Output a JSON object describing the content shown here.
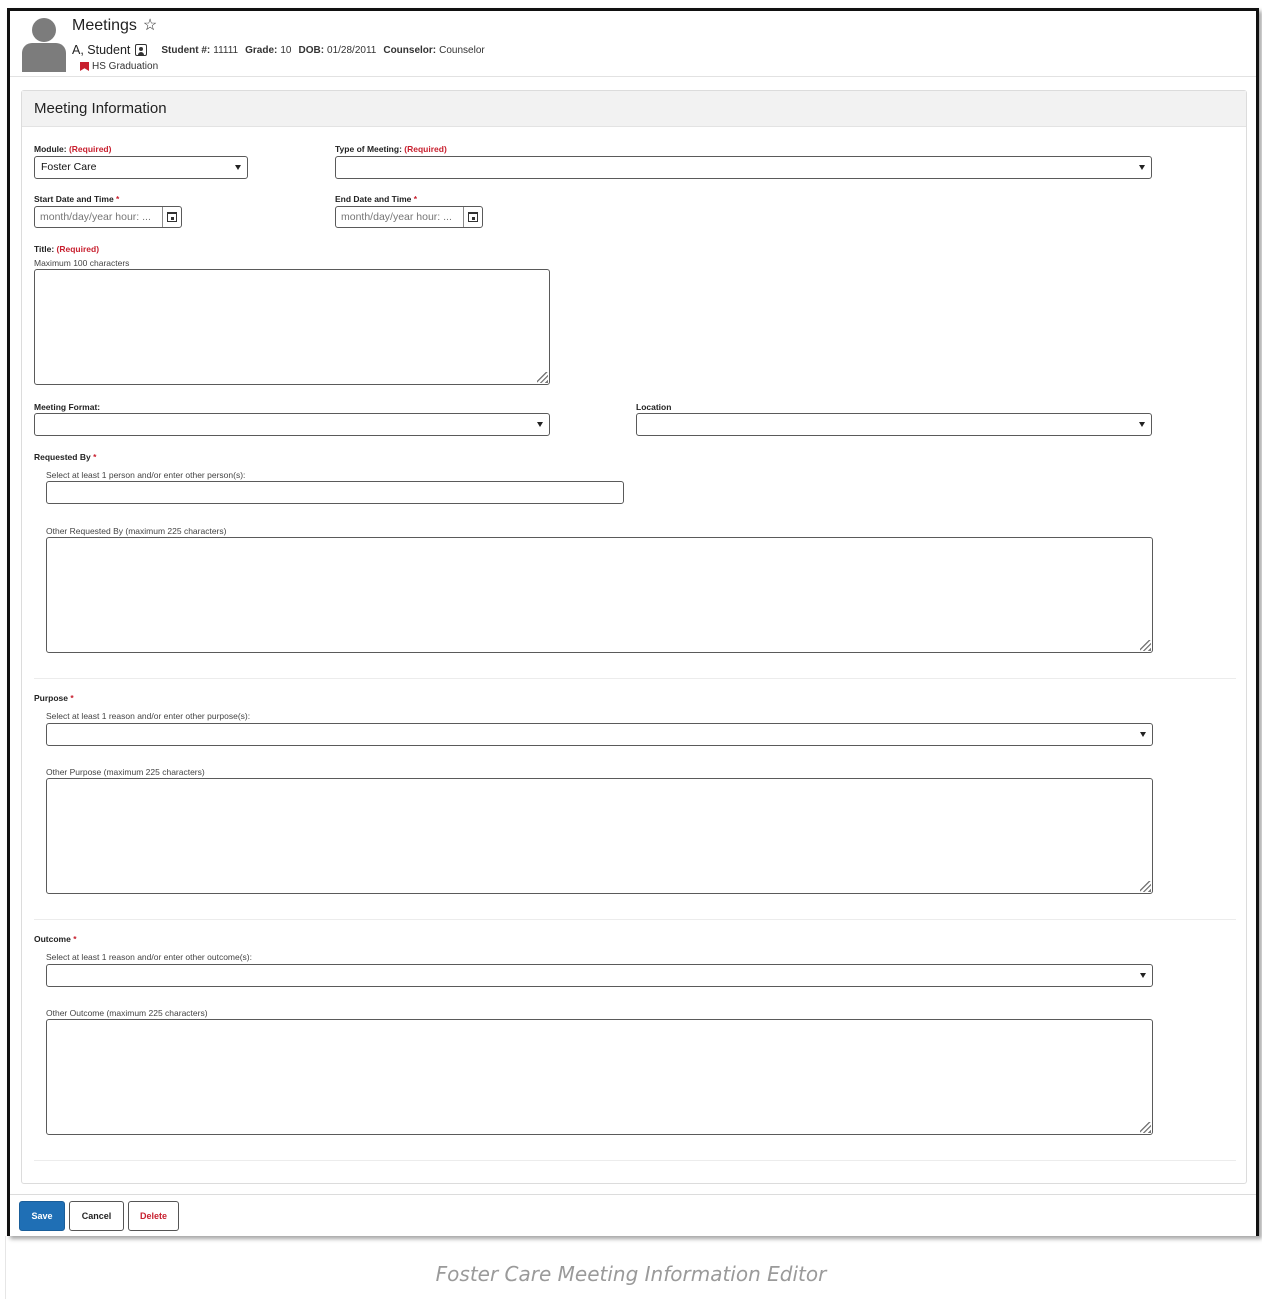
{
  "header": {
    "title": "Meetings",
    "student_name": "A, Student",
    "student_num_label": "Student #:",
    "student_num": "11111",
    "grade_label": "Grade:",
    "grade": "10",
    "dob_label": "DOB:",
    "dob": "01/28/2011",
    "counselor_label": "Counselor:",
    "counselor": "Counselor",
    "graduation": "HS Graduation"
  },
  "panel": {
    "title": "Meeting Information"
  },
  "form": {
    "module_label": "Module:",
    "required_text": "(Required)",
    "module_value": "Foster Care",
    "type_label": "Type of Meeting:",
    "type_value": "",
    "start_label": "Start Date and Time",
    "start_placeholder": "month/day/year hour: ...",
    "end_label": "End Date and Time",
    "end_placeholder": "month/day/year hour: ...",
    "asterisk": "*",
    "title_label": "Title:",
    "title_hint": "Maximum 100 characters",
    "format_label": "Meeting Format:",
    "format_value": "",
    "location_label": "Location",
    "location_value": "",
    "requested_label": "Requested By",
    "requested_hint": "Select at least 1 person and/or enter other person(s):",
    "other_requested_label": "Other Requested By (maximum 225 characters)",
    "purpose_label": "Purpose",
    "purpose_hint": "Select at least 1 reason and/or enter other purpose(s):",
    "other_purpose_label": "Other Purpose (maximum 225 characters)",
    "outcome_label": "Outcome",
    "outcome_hint": "Select at least 1 reason and/or enter other outcome(s):",
    "other_outcome_label": "Other Outcome (maximum 225 characters)"
  },
  "footer": {
    "save": "Save",
    "cancel": "Cancel",
    "delete": "Delete"
  },
  "caption": "Foster Care Meeting Information Editor",
  "colors": {
    "primary": "#1f6fb5",
    "required": "#c8202f"
  }
}
